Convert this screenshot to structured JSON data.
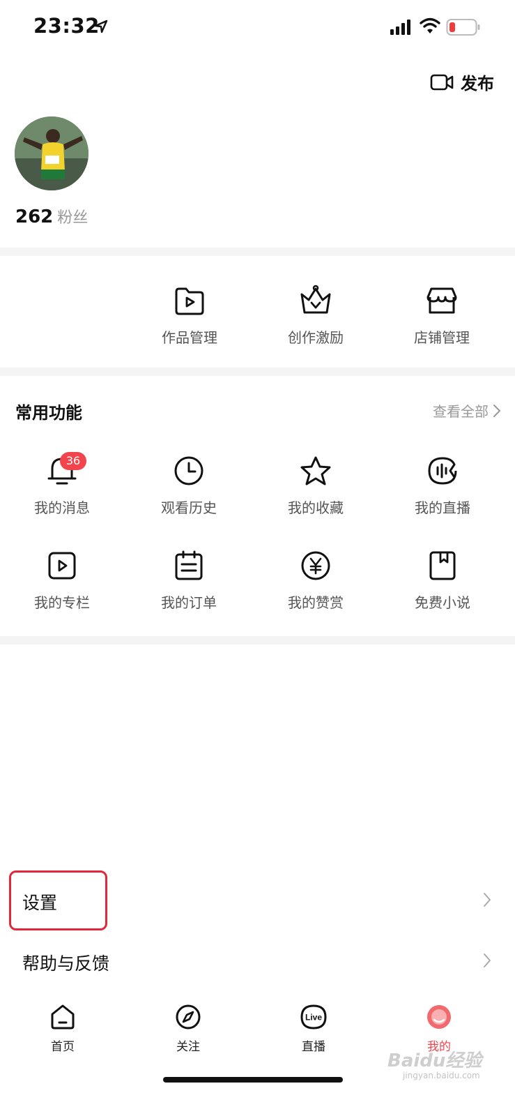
{
  "status_bar": {
    "time": "23:32"
  },
  "header": {
    "publish_label": "发布"
  },
  "profile": {
    "fans_count": "262",
    "fans_label": "粉丝"
  },
  "creator_tools": [
    {
      "label": "作品管理",
      "icon": "folder-play-icon"
    },
    {
      "label": "创作激励",
      "icon": "crown-icon"
    },
    {
      "label": "店铺管理",
      "icon": "shop-icon"
    }
  ],
  "common": {
    "title": "常用功能",
    "view_all": "查看全部",
    "items": [
      {
        "label": "我的消息",
        "icon": "bell-icon",
        "badge": "36"
      },
      {
        "label": "观看历史",
        "icon": "clock-icon"
      },
      {
        "label": "我的收藏",
        "icon": "star-icon"
      },
      {
        "label": "我的直播",
        "icon": "live-wave-icon"
      },
      {
        "label": "我的专栏",
        "icon": "column-play-icon"
      },
      {
        "label": "我的订单",
        "icon": "order-icon"
      },
      {
        "label": "我的赞赏",
        "icon": "yen-icon"
      },
      {
        "label": "免费小说",
        "icon": "book-icon"
      }
    ]
  },
  "list": [
    {
      "label": "设置"
    },
    {
      "label": "帮助与反馈"
    }
  ],
  "tabbar": [
    {
      "label": "首页",
      "icon": "home-icon"
    },
    {
      "label": "关注",
      "icon": "compass-icon"
    },
    {
      "label": "直播",
      "icon": "live-icon"
    },
    {
      "label": "我的",
      "icon": "profile-icon",
      "active": true
    }
  ],
  "watermark": {
    "text": "Baidu经验",
    "sub": "jingyan.baidu.com"
  },
  "colors": {
    "accent": "#f2444c",
    "highlight": "#e3273a",
    "divider": "#f4f4f4",
    "secondary_text": "#999999"
  }
}
